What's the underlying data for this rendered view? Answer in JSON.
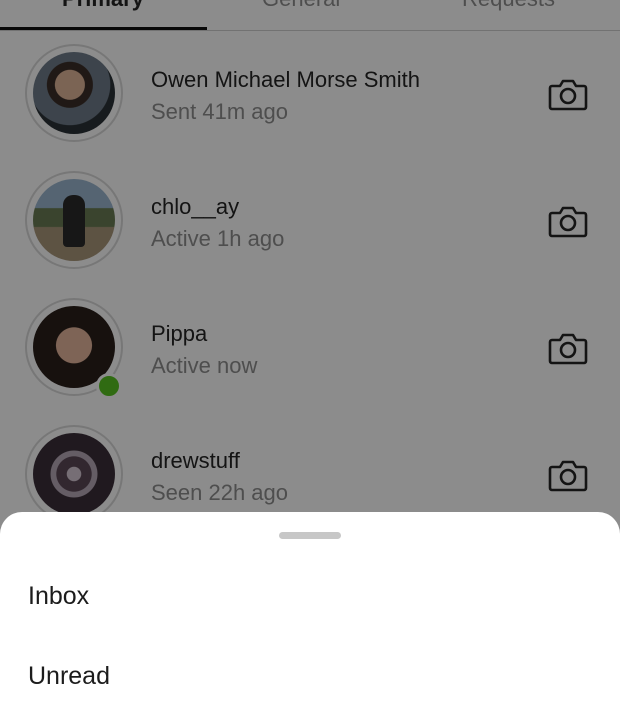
{
  "tabs": [
    "Primary",
    "General",
    "Requests"
  ],
  "contacts": [
    {
      "name": "Owen Michael Morse Smith",
      "status": "Sent 41m ago",
      "online": false
    },
    {
      "name": "chlo__ay",
      "status": "Active 1h ago",
      "online": false
    },
    {
      "name": "Pippa",
      "status": "Active now",
      "online": true
    },
    {
      "name": "drewstuff",
      "status": "Seen 22h ago",
      "online": false
    }
  ],
  "sheet": {
    "options": [
      "Inbox",
      "Unread"
    ]
  },
  "colors": {
    "online": "#58c322",
    "secondary_text": "#8e8e8e",
    "primary_text": "#262626"
  },
  "icons": {
    "row_action": "camera-icon"
  }
}
